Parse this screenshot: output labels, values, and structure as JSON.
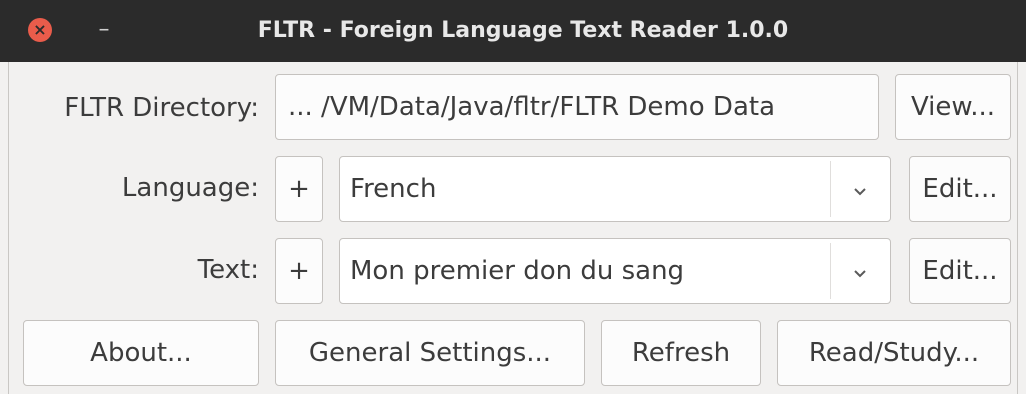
{
  "window": {
    "title": "FLTR - Foreign Language Text Reader 1.0.0",
    "close_icon": "close-icon",
    "minimize_icon": "minimize-icon"
  },
  "directory": {
    "label": "FLTR Directory:",
    "path": "... /VM/Data/Java/fltr/FLTR Demo Data",
    "view_button": "View..."
  },
  "language": {
    "label": "Language:",
    "add_button": "+",
    "selected": "French",
    "edit_button": "Edit..."
  },
  "text": {
    "label": "Text:",
    "add_button": "+",
    "selected": "Mon premier don du sang",
    "edit_button": "Edit..."
  },
  "actions": {
    "about": "About...",
    "general_settings": "General Settings...",
    "refresh": "Refresh",
    "read_study": "Read/Study..."
  },
  "colors": {
    "titlebar": "#2b2b2b",
    "close_button": "#e95c4b",
    "window_bg": "#f2f1f0"
  }
}
